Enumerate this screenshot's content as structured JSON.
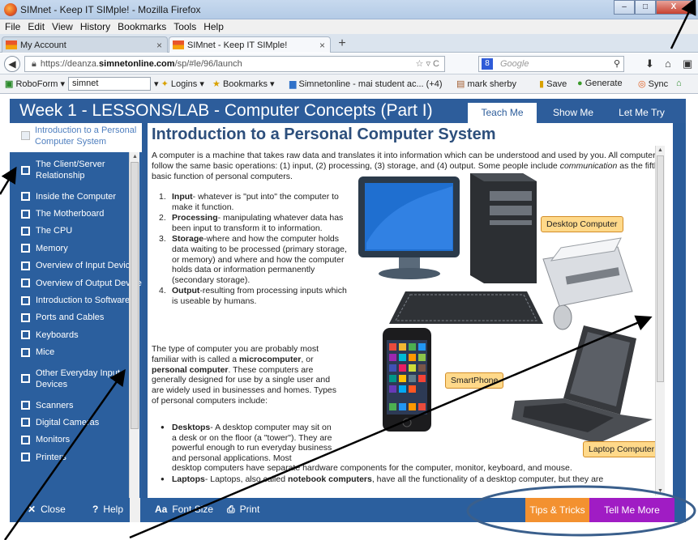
{
  "browser": {
    "window_title": "SIMnet - Keep IT SIMple! - Mozilla Firefox",
    "window_buttons": {
      "minimize": "–",
      "maximize": "□",
      "close": "X"
    },
    "menu": [
      "File",
      "Edit",
      "View",
      "History",
      "Bookmarks",
      "Tools",
      "Help"
    ],
    "tabs": [
      {
        "label": "My Account",
        "close": "×"
      },
      {
        "label": "SIMnet - Keep IT SIMple!",
        "close": "×"
      }
    ],
    "new_tab": "+",
    "url_prefix": "https://deanza.",
    "url_domain": "simnetonline.com",
    "url_suffix": "/sp/#le/96/launch",
    "search_placeholder": "Google",
    "bookmarks_bar": {
      "roboform": "RoboForm",
      "roboform_input": "simnet",
      "logins": "Logins",
      "bookmarks": "Bookmarks",
      "simnetonline": "Simnetonline - mai student ac...",
      "count": "(+4)",
      "user": "mark sherby",
      "save": "Save",
      "generate": "Generate",
      "sync": "Sync"
    }
  },
  "app": {
    "title": "Week 1 - LESSONS/LAB - Computer Concepts (Part I)",
    "mode_tabs": [
      "Teach Me",
      "Show Me",
      "Let Me Try"
    ],
    "sidebar": {
      "current": "Introduction to a Personal Computer System",
      "items": [
        "The Client/Server Relationship",
        "Inside the Computer",
        "The Motherboard",
        "The CPU",
        "Memory",
        "Overview of Input Devices",
        "Overview of Output Devices",
        "Introduction to Software",
        "Ports and Cables",
        "Keyboards",
        "Mice",
        "Other Everyday Input Devices",
        "Scanners",
        "Digital Cameras",
        "Monitors",
        "Printers"
      ]
    },
    "content": {
      "heading": "Introduction to a Personal Computer System",
      "intro": {
        "before": "A computer is a machine that takes raw data and translates it into information which can be understood and used by you. All computers follow the same basic operations: (1) input, (2) processing, (3) storage, and (4) output. Some people include ",
        "em": "communication",
        "after": " as the fifth basic function of personal computers."
      },
      "list": [
        {
          "num": "1.",
          "term": "Input",
          "text": "- whatever is \"put into\" the computer to make it function."
        },
        {
          "num": "2.",
          "term": "Processing",
          "text": "- manipulating whatever data has been input to transform it to information."
        },
        {
          "num": "3.",
          "term": "Storage",
          "text": "-where and how the computer holds data waiting to be processed (primary storage, or memory) and where and how the computer holds data or information permanently (secondary storage)."
        },
        {
          "num": "4.",
          "term": "Output",
          "text": "-resulting from processing inputs which is useable by humans."
        }
      ],
      "para2": {
        "a": "The type of computer you are probably most familiar with is called a ",
        "b1": "microcomputer",
        "c": ", or ",
        "b2": "personal computer",
        "d": ". These computers are generally designed for use by a single user and are widely used in businesses and homes. Types of personal computers include:"
      },
      "bullet1": {
        "term": "Desktops",
        "narrow": "- A desktop computer may sit on a desk or on the floor (a \"tower\"). They are powerful enough to run everyday business and personal applications. Most",
        "wide": "desktop computers have separate hardware components for the computer, monitor, keyboard, and mouse."
      },
      "bullet2": {
        "term": "Laptops",
        "before": "- Laptops, also called ",
        "bold": "notebook computers",
        "after": ", have all the functionality of a desktop computer, but they are"
      },
      "image_labels": {
        "desktop": "Desktop Computer",
        "smartphone": "SmartPhone",
        "laptop": "Laptop Computer"
      }
    },
    "bottom_bar": {
      "close": "Close",
      "help": "Help",
      "font_size": "Font Size",
      "print": "Print",
      "tips": "Tips & Tricks",
      "tell_more": "Tell Me More"
    }
  },
  "colors": {
    "app_blue": "#2b5f9e",
    "heading_blue": "#2d4f7c",
    "tips_orange": "#f39130",
    "more_purple": "#a01cc4",
    "label_fill": "#ffd98a",
    "annotation_ellipse": "#3a5f8c"
  },
  "icons": [
    "firefox-icon",
    "back-arrow-icon",
    "lock-icon",
    "star-icon",
    "reload-icon",
    "download-icon",
    "home-icon",
    "close-x-icon",
    "help-icon",
    "font-size-icon",
    "print-icon",
    "checkbox-icon"
  ]
}
